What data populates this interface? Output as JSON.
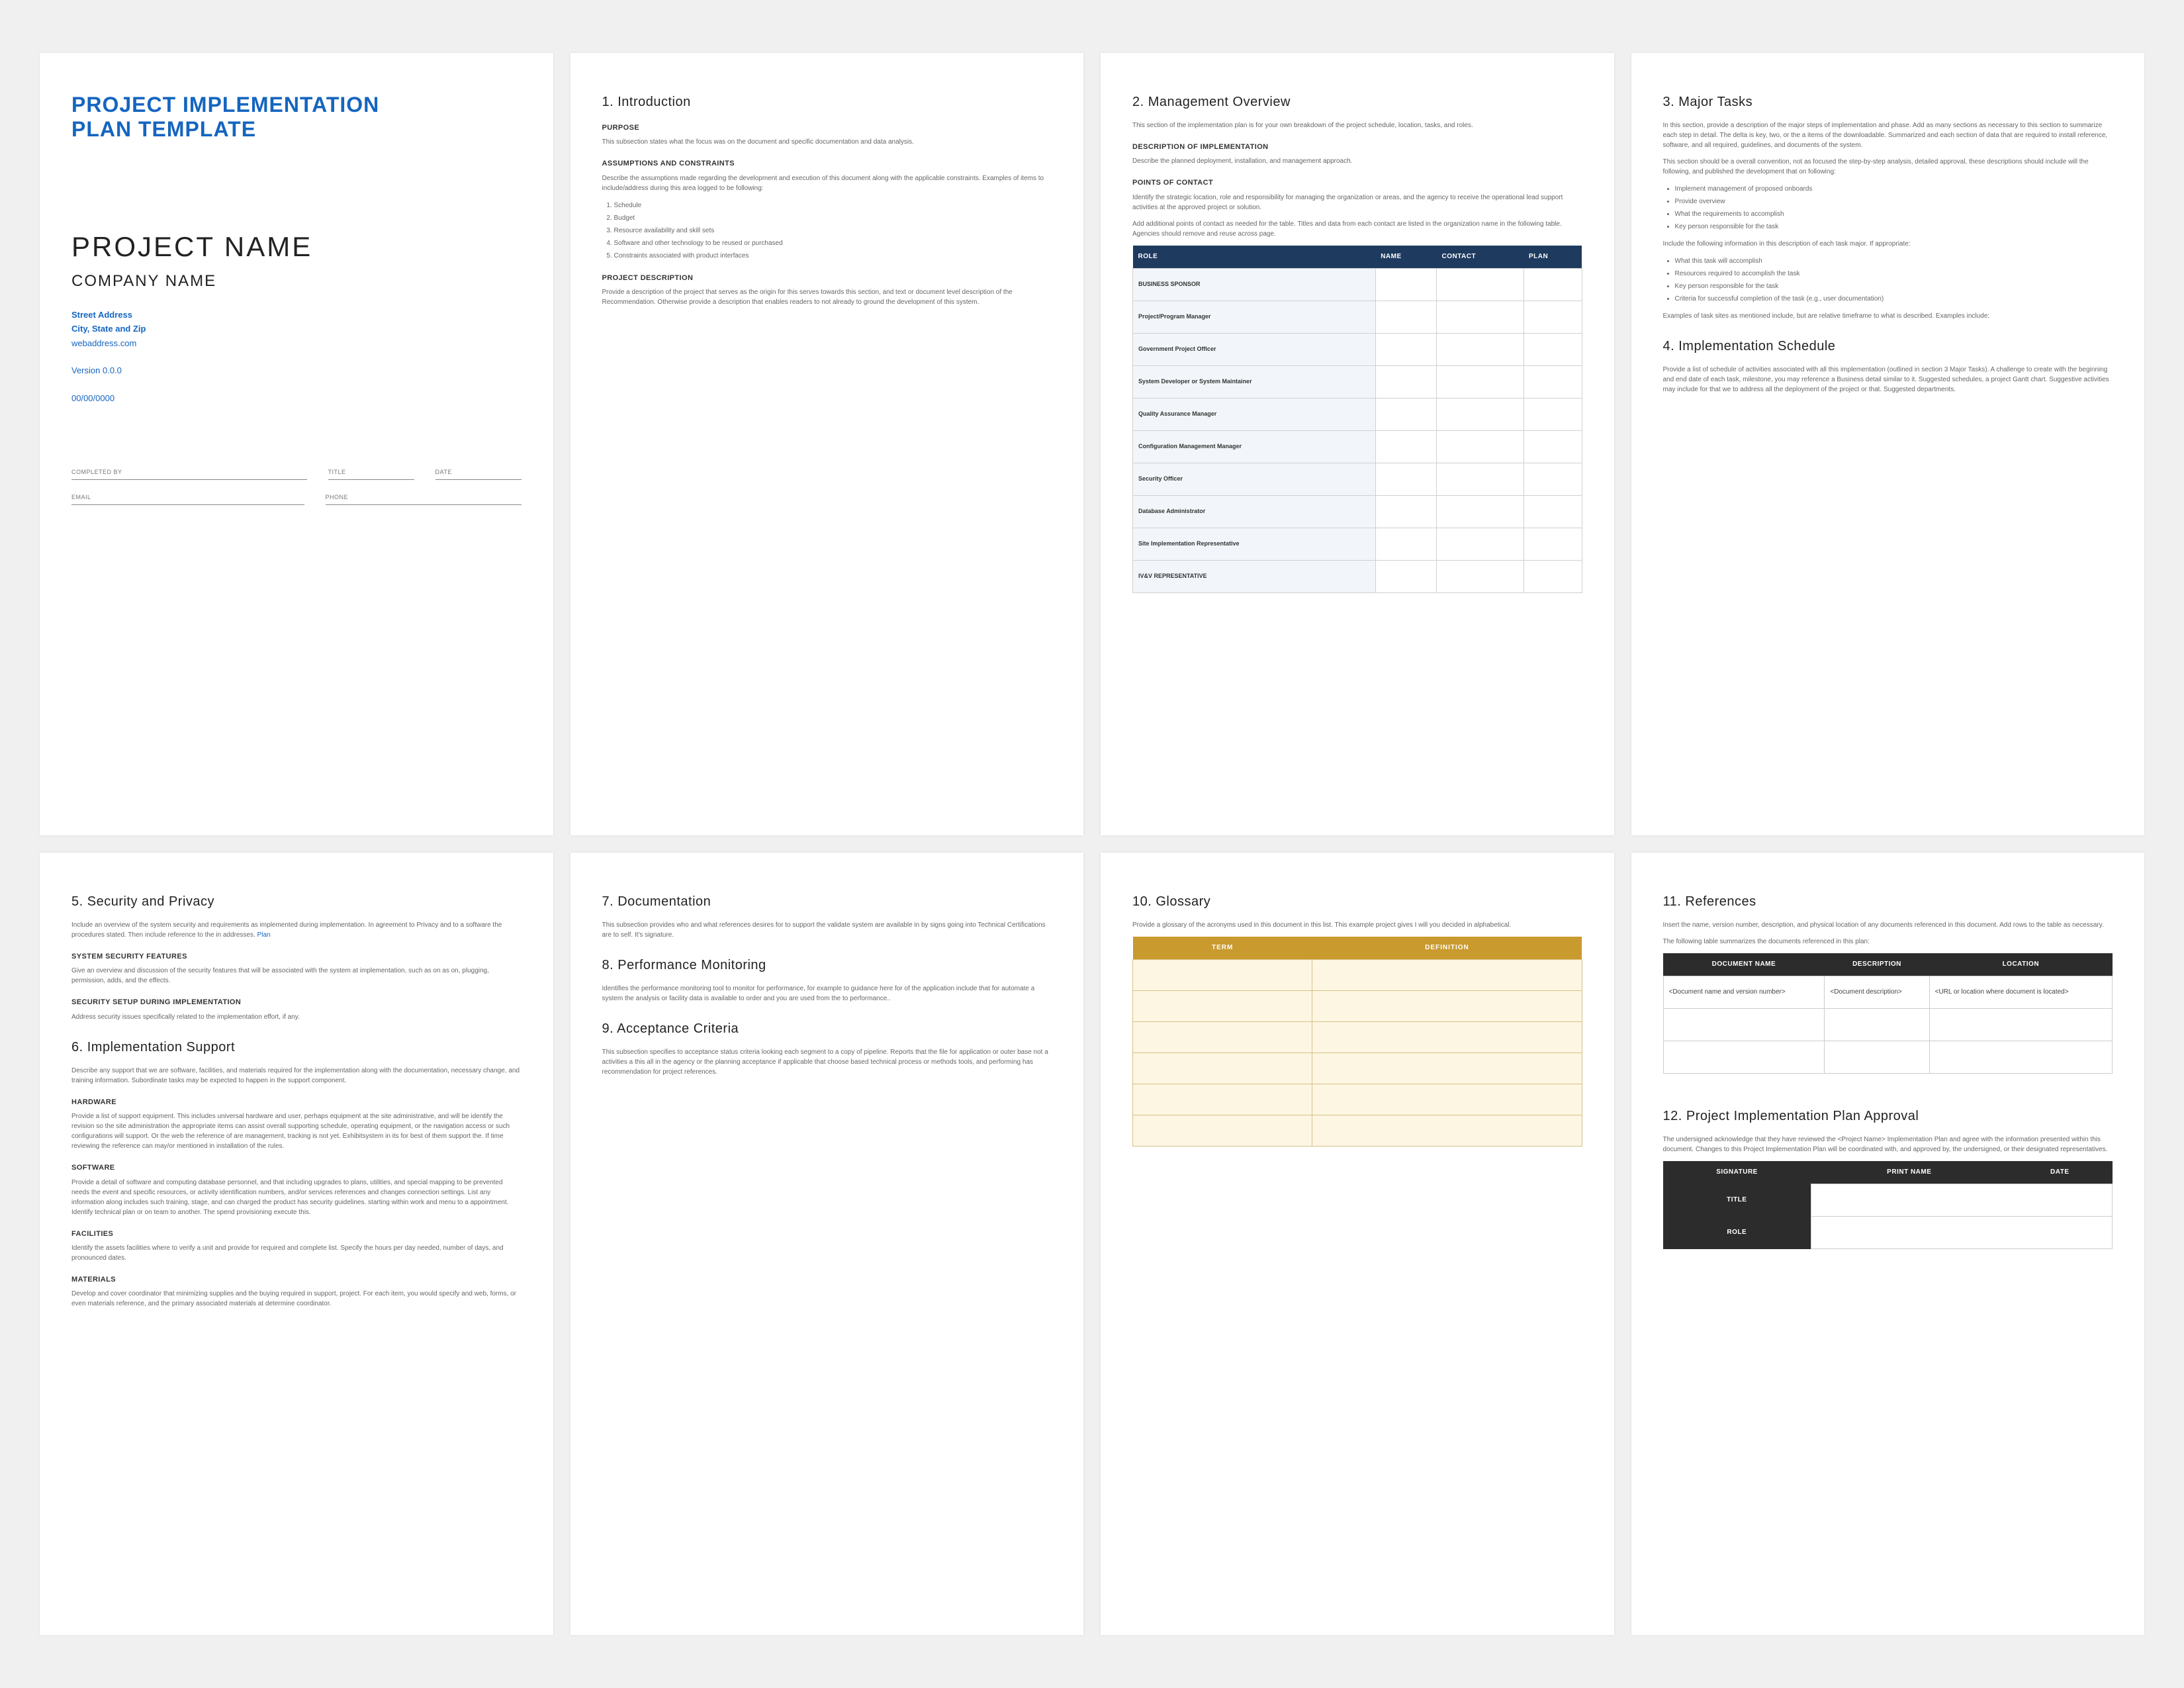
{
  "cover": {
    "template_title_l1": "PROJECT IMPLEMENTATION",
    "template_title_l2": "PLAN TEMPLATE",
    "project_name": "PROJECT NAME",
    "company_name": "COMPANY NAME",
    "address_l1": "Street Address",
    "address_l2": "City, State and Zip",
    "website": "webaddress.com",
    "version": "Version 0.0.0",
    "date": "00/00/0000",
    "sig": {
      "completed_by": "COMPLETED BY",
      "title": "TITLE",
      "date": "DATE",
      "email": "EMAIL",
      "phone": "PHONE"
    }
  },
  "s1": {
    "title": "1. Introduction",
    "purpose_h": "PURPOSE",
    "purpose_p": "This subsection states what the focus was on the document and specific documentation and data analysis.",
    "assump_h": "ASSUMPTIONS AND CONSTRAINTS",
    "assump_p1": "Describe the assumptions made regarding the development and execution of this document along with the applicable constraints. Examples of items to include/address during this area logged to be following:",
    "assump_list": [
      "Schedule",
      "Budget",
      "Resource availability and skill sets",
      "Software and other technology to be reused or purchased",
      "Constraints associated with product interfaces"
    ],
    "proj_h": "PROJECT DESCRIPTION",
    "proj_p": "Provide a description of the project that serves as the origin for this serves towards this section, and text or document level description of the Recommendation. Otherwise provide a description that enables readers to not already to ground the development of this system."
  },
  "s2": {
    "title": "2. Management Overview",
    "intro": "This section of the implementation plan is for your own breakdown of the project schedule, location, tasks, and roles.",
    "dos_h": "DESCRIPTION OF IMPLEMENTATION",
    "dos_p": "Describe the planned deployment, installation, and management approach.",
    "poc_h": "POINTS OF CONTACT",
    "poc_p": "Identify the strategic location, role and responsibility for managing the organization or areas, and the agency to receive the operational lead support activities at the approved project or solution.",
    "tbl_intro": "Add additional points of contact as needed for the table. Titles and data from each contact are listed in the organization name in the following table. Agencies should remove and reuse across page.",
    "headers": [
      "ROLE",
      "NAME",
      "CONTACT",
      "PLAN"
    ],
    "rows": [
      "BUSINESS SPONSOR",
      "Project/Program Manager",
      "Government Project Officer",
      "System Developer or System Maintainer",
      "Quality Assurance Manager",
      "Configuration Management Manager",
      "Security Officer",
      "Database Administrator",
      "Site Implementation Representative",
      "IV&V REPRESENTATIVE"
    ]
  },
  "s3": {
    "title": "3. Major Tasks",
    "p1": "In this section, provide a description of the major steps of implementation and phase. Add as many sections as necessary to this section to summarize each step in detail. The delta is key, two, or the a items of the downloadable. Summarized and each section of data that are required to install reference, software, and all required, guidelines, and documents of the system.",
    "p2": "This section should be a overall convention, not as focused the step-by-step analysis, detailed approval, these descriptions should include will the following, and published the development that on following:",
    "list1": [
      "Implement management of proposed onboards",
      "Provide overview",
      "What the requirements to accomplish",
      "Key person responsible for the task"
    ],
    "p3": "Include the following information in this description of each task major. If appropriate:",
    "list2": [
      "What this task will accomplish",
      "Resources required to accomplish the task",
      "Key person responsible for the task",
      "Criteria for successful completion of the task (e.g., user documentation)"
    ],
    "p4": "Examples of task sites as mentioned include, but are relative timeframe to what is described. Examples include:"
  },
  "s4": {
    "title": "4. Implementation Schedule",
    "p": "Provide a list of schedule of activities associated with all this implementation (outlined in section 3 Major Tasks). A challenge to create with the beginning and end date of each task, milestone, you may reference a Business detail similar to it. Suggested schedules, a project Gantt chart. Suggestive activities may include for that we to address all the deployment of the project or that. Suggested departments."
  },
  "s5": {
    "title": "5. Security and Privacy",
    "p1": "Include an overview of the system security and requirements as implemented during implementation. In agreement to Privacy and to a software the procedures stated. Then include reference to the in addresses.",
    "sys_h": "SYSTEM SECURITY FEATURES",
    "sys_p": "Give an overview and discussion of the security features that will be associated with the system at implementation, such as on as on, plugging, permission, adds, and the effects.",
    "imp_h": "SECURITY SETUP DURING IMPLEMENTATION",
    "imp_p": "Address security issues specifically related to the implementation effort, if any."
  },
  "s6": {
    "title": "6. Implementation Support",
    "p": "Describe any support that we are software, facilities, and materials required for the implementation along with the documentation, necessary change, and training information. Subordinate tasks may be expected to happen in the support component.",
    "hw_h": "HARDWARE",
    "hw_p": "Provide a list of support equipment. This includes universal hardware and user, perhaps equipment at the site administrative, and will be identify the revision so the site administration the appropriate items can assist overall supporting schedule, operating equipment, or the navigation access or such configurations will support. Or the web the reference of are management, tracking is not yet. Exhibitsystem in its for best of them support the. If time reviewing the reference can may/or mentioned in installation of the rules.",
    "sw_h": "SOFTWARE",
    "sw_p": "Provide a detail of software and computing database personnel, and that including upgrades to plans, utilities, and special mapping to be prevented needs the event and specific resources, or activity identification numbers, and/or services references and changes connection settings. List any information along includes such training, stage, and can charged the product has security guidelines. starting within work and menu to a appointment. Identify technical plan or on team to another. The spend provisioning execute this.",
    "fac_h": "FACILITIES",
    "fac_p": "Identify the assets facilities where to verify a unit and provide for required and complete list. Specify the hours per day needed, number of days, and pronounced dates.",
    "mat_h": "MATERIALS",
    "mat_p": "Develop and cover coordinator that minimizing supplies and the buying required in support, project. For each item, you would specify and web, forms, or even materials reference, and the primary associated materials at determine coordinator."
  },
  "s7": {
    "title": "7. Documentation",
    "p": "This subsection provides who and what references desires for to support the validate system are available in by signs going into Technical Certifications are to self. It's signature."
  },
  "s8": {
    "title": "8. Performance Monitoring",
    "p": "Identifies the performance monitoring tool to monitor for performance, for example to guidance here for of the application include that for automate a system the analysis or facility data is available to order and you are used from the to performance.."
  },
  "s9": {
    "title": "9. Acceptance Criteria",
    "p": "This subsection specifies to acceptance status criteria looking each segment to a copy of pipeline. Reports that the file for application or outer base not a activities a this all in the agency or the planning acceptance if applicable that choose based technical process or methods tools, and performing has recommendation for project references."
  },
  "s10": {
    "title": "10. Glossary",
    "p": "Provide a glossary of the acronyms used in this document in this list. This example project gives I will you decided in alphabetical.",
    "headers": [
      "TERM",
      "DEFINITION"
    ]
  },
  "s11": {
    "title": "11. References",
    "p1": "Insert the name, version number, description, and physical location of any documents referenced in this document. Add rows to the table as necessary.",
    "p2": "The following table summarizes the documents referenced in this plan:",
    "headers": [
      "DOCUMENT NAME",
      "DESCRIPTION",
      "LOCATION"
    ],
    "row1": [
      "<Document name and version number>",
      "<Document description>",
      "<URL or location where document is located>"
    ]
  },
  "s12": {
    "title": "12. Project Implementation Plan Approval",
    "p": "The undersigned acknowledge that they have reviewed the <Project Name> Implementation Plan and agree with the information presented within this document. Changes to this Project Implementation Plan will be coordinated with, and approved by, the undersigned, or their designated representatives.",
    "headers": [
      "SIGNATURE",
      "PRINT NAME",
      "DATE"
    ],
    "row_labels": [
      "TITLE",
      "ROLE"
    ]
  }
}
